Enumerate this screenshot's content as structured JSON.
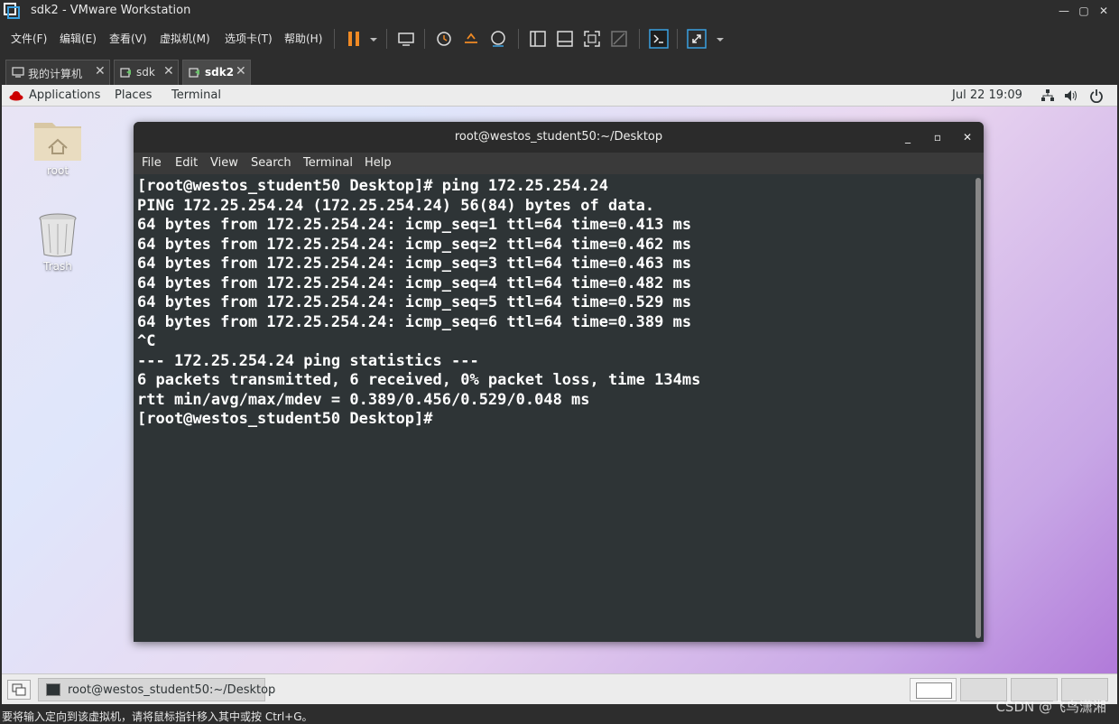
{
  "vmware": {
    "title": "sdk2 - VMware Workstation",
    "menu": [
      "文件(F)",
      "编辑(E)",
      "查看(V)",
      "虚拟机(M)",
      "选项卡(T)",
      "帮助(H)"
    ],
    "tabs": [
      {
        "label": "我的计算机"
      },
      {
        "label": "sdk"
      },
      {
        "label": "sdk2"
      }
    ],
    "status_message": "要将输入定向到该虚拟机，请将鼠标指针移入其中或按 Ctrl+G。",
    "watermark": "CSDN @飞鸟潇湘"
  },
  "gnome": {
    "applications": "Applications",
    "places": "Places",
    "terminal": "Terminal",
    "clock": "Jul 22  19:09"
  },
  "desktop": {
    "icons": [
      {
        "label": "root"
      },
      {
        "label": "Trash"
      }
    ]
  },
  "terminal": {
    "title": "root@westos_student50:~/Desktop",
    "menu": [
      "File",
      "Edit",
      "View",
      "Search",
      "Terminal",
      "Help"
    ],
    "lines": [
      "[root@westos_student50 Desktop]# ping 172.25.254.24",
      "PING 172.25.254.24 (172.25.254.24) 56(84) bytes of data.",
      "64 bytes from 172.25.254.24: icmp_seq=1 ttl=64 time=0.413 ms",
      "64 bytes from 172.25.254.24: icmp_seq=2 ttl=64 time=0.462 ms",
      "64 bytes from 172.25.254.24: icmp_seq=3 ttl=64 time=0.463 ms",
      "64 bytes from 172.25.254.24: icmp_seq=4 ttl=64 time=0.482 ms",
      "64 bytes from 172.25.254.24: icmp_seq=5 ttl=64 time=0.529 ms",
      "64 bytes from 172.25.254.24: icmp_seq=6 ttl=64 time=0.389 ms",
      "^C",
      "--- 172.25.254.24 ping statistics ---",
      "6 packets transmitted, 6 received, 0% packet loss, time 134ms",
      "rtt min/avg/max/mdev = 0.389/0.456/0.529/0.048 ms",
      "[root@westos_student50 Desktop]# "
    ]
  },
  "taskbar": {
    "task_label": "root@westos_student50:~/Desktop"
  },
  "colors": {
    "terminal_bg": "#2e3436",
    "vmware_chrome": "#2d2d2d",
    "pause_orange": "#f08a24"
  }
}
